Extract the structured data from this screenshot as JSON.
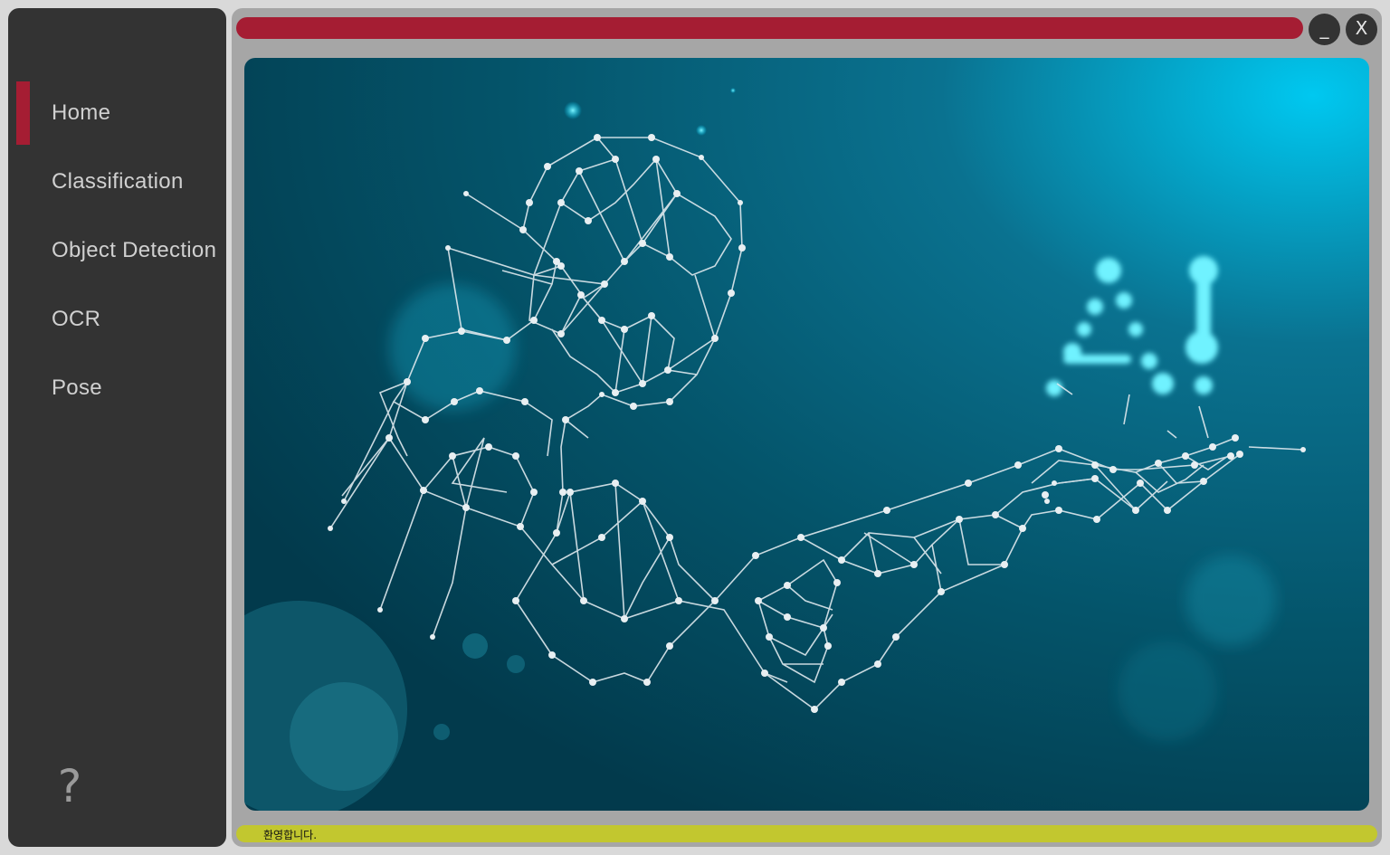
{
  "sidebar": {
    "items": [
      {
        "label": "Home",
        "active": true
      },
      {
        "label": "Classification",
        "active": false
      },
      {
        "label": "Object Detection",
        "active": false
      },
      {
        "label": "OCR",
        "active": false
      },
      {
        "label": "Pose",
        "active": false
      }
    ],
    "help_label": "?"
  },
  "window": {
    "minimize_label": "_",
    "close_label": "X"
  },
  "hero": {
    "ai_text": "AI",
    "icon": "ai-network-figure-illustration"
  },
  "status": {
    "message": "환영합니다."
  },
  "colors": {
    "accent": "#a51d33",
    "sidebar_bg": "#333333",
    "status_bar": "#c2c72f"
  }
}
